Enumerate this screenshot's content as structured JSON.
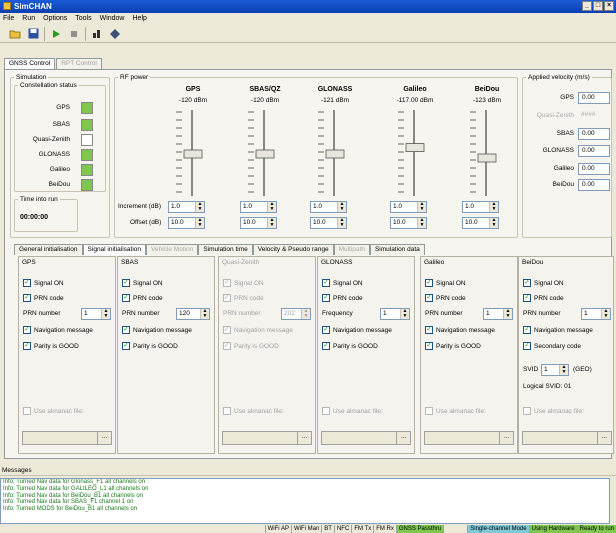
{
  "window": {
    "title": "SimCHAN",
    "controls": [
      "_",
      "□",
      "×"
    ]
  },
  "menu": [
    "File",
    "Run",
    "Options",
    "Tools",
    "Window",
    "Help"
  ],
  "toolbar": {
    "icons": [
      "open-icon",
      "save-icon",
      "play-icon",
      "stop-icon",
      "bars-icon",
      "satellite-icon"
    ]
  },
  "main_tabs": [
    {
      "label": "GNSS Control",
      "active": true
    },
    {
      "label": "RPT Control",
      "disabled": true
    }
  ],
  "simulation": {
    "legend": "Simulation",
    "constellation_legend": "Constellation status",
    "constellations": [
      {
        "name": "GPS",
        "color": "#7ec850"
      },
      {
        "name": "SBAS",
        "color": "#7ec850"
      },
      {
        "name": "Quasi-Zenith",
        "color": "#ffffff"
      },
      {
        "name": "GLONASS",
        "color": "#7ec850"
      },
      {
        "name": "Galileo",
        "color": "#7ec850"
      },
      {
        "name": "BeiDou",
        "color": "#7ec850"
      }
    ],
    "time_legend": "Time into run",
    "time": "00:00:00"
  },
  "rf_power": {
    "legend": "RF power",
    "increment_label": "Increment (dB)",
    "offset_label": "Offset (dB)",
    "columns": [
      {
        "name": "GPS",
        "dbm": "-120 dBm",
        "increment": "1.0",
        "offset": "10.0",
        "level": 0.5
      },
      {
        "name": "SBAS/QZ",
        "dbm": "-120 dBm",
        "increment": "1.0",
        "offset": "10.0",
        "level": 0.5
      },
      {
        "name": "GLONASS",
        "dbm": "-121 dBm",
        "increment": "1.0",
        "offset": "10.0",
        "level": 0.5
      },
      {
        "name": "Galileo",
        "dbm": "-117.00 dBm",
        "increment": "1.0",
        "offset": "10.0",
        "level": 0.42
      },
      {
        "name": "BeiDou",
        "dbm": "-123 dBm",
        "increment": "1.0",
        "offset": "10.0",
        "level": 0.55
      }
    ]
  },
  "velocity": {
    "legend": "Applied velocity (m/s)",
    "rows": [
      {
        "name": "GPS",
        "value": "0.00"
      },
      {
        "name": "Quasi-Zenith",
        "value": "####",
        "disabled": true
      },
      {
        "name": "SBAS",
        "value": "0.00"
      },
      {
        "name": "GLONASS",
        "value": "0.00"
      },
      {
        "name": "Galileo",
        "value": "0.00"
      },
      {
        "name": "BeiDou",
        "value": "0.00"
      }
    ]
  },
  "sub_tabs": [
    {
      "label": "General initialisation"
    },
    {
      "label": "Signal initialisation",
      "active": true
    },
    {
      "label": "Vehicle Motion",
      "disabled": true
    },
    {
      "label": "Simulation time"
    },
    {
      "label": "Velocity & Pseudo range"
    },
    {
      "label": "Multipath",
      "disabled": true
    },
    {
      "label": "Simulation data"
    }
  ],
  "satellites": [
    {
      "title": "GPS",
      "signal_on": "Signal ON",
      "prn_code": "PRN code",
      "num_label": "PRN number",
      "num": "1",
      "nav": "Navigation message",
      "parity": "Parity is GOOD",
      "almanac": "Use almanac file:"
    },
    {
      "title": "SBAS",
      "signal_on": "Signal ON",
      "prn_code": "PRN code",
      "num_label": "PRN number",
      "num": "120",
      "nav": "Navigation message",
      "parity": "Parity is GOOD",
      "almanac": ""
    },
    {
      "title": "Quasi-Zenith",
      "signal_on": "Signal ON",
      "prn_code": "PRN code",
      "num_label": "PRN number",
      "num": "202",
      "nav": "Navigation message",
      "parity": "Parity is GOOD",
      "almanac": "Use almanac file:",
      "disabled": true
    },
    {
      "title": "GLONASS",
      "signal_on": "Signal ON",
      "prn_code": "PRN code",
      "num_label": "Frequency",
      "num": "1",
      "nav": "Navigation message",
      "parity": "Parity is GOOD",
      "almanac": "Use almanac file:"
    },
    {
      "title": "Galileo",
      "signal_on": "Signal ON",
      "prn_code": "PRN code",
      "num_label": "PRN number",
      "num": "1",
      "nav": "Navigation message",
      "parity": "Parity is GOOD",
      "almanac": "Use almanac file:"
    },
    {
      "title": "BeiDou",
      "signal_on": "Signal ON",
      "prn_code": "PRN code",
      "num_label": "PRN number",
      "num": "1",
      "nav": "Navigation message",
      "parity": "Secondary code",
      "almanac": "Use almanac file:",
      "svid_label": "SVID",
      "svid": "1",
      "geo": "(GEO)",
      "logical": "Logical SVID: 01"
    }
  ],
  "messages": {
    "title": "Messages",
    "lines": [
      "Info: Turned Nav data for Glonass_F1 all channels on",
      "Info: Turned Nav data for GALILEO_L1 all channels on",
      "Info: Turned Nav data for BeiDou_B1 all channels on",
      "Info: Turned Nav data for SBAS_F1 channel 1 on",
      "Info: Turned MODS for BeiDou_B1 all channels on"
    ]
  },
  "statusbar": [
    "WiFi AP",
    "WiFi Man",
    "BT",
    "NFC",
    "FM Tx",
    "FM Rx",
    "GNSS Passthru",
    "",
    "Single-channel Mode",
    "Using Hardware",
    "Ready to run"
  ],
  "statusbar_colors": {
    "GNSS Passthru": "#7ec850",
    "Single-channel Mode": "#7ec8d8",
    "Using Hardware": "#7ec850",
    "Ready to run": "#7ec850"
  }
}
